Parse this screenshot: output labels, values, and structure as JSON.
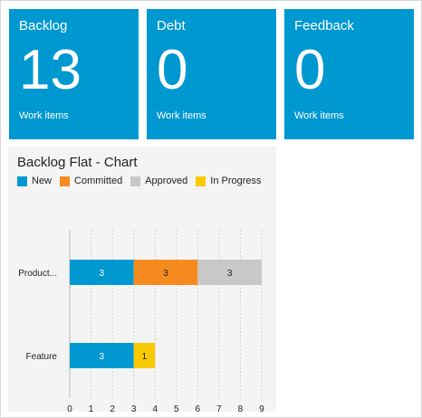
{
  "tiles": [
    {
      "title": "Backlog",
      "count": "13",
      "subtitle": "Work items"
    },
    {
      "title": "Debt",
      "count": "0",
      "subtitle": "Work items"
    },
    {
      "title": "Feedback",
      "count": "0",
      "subtitle": "Work items"
    }
  ],
  "colors": {
    "tile": "#0098d0",
    "New": "#0098d0",
    "Committed": "#f58b1f",
    "Approved": "#c8c8c8",
    "In Progress": "#f8c900"
  },
  "chart_data": {
    "type": "bar",
    "orientation": "horizontal",
    "stacked": true,
    "title": "Backlog Flat - Chart",
    "legend": [
      "New",
      "Committed",
      "Approved",
      "In Progress"
    ],
    "legend_position": "top-left",
    "categories": [
      "Product...",
      "Feature"
    ],
    "series": [
      {
        "name": "New",
        "values": [
          3,
          3
        ]
      },
      {
        "name": "Committed",
        "values": [
          3,
          0
        ]
      },
      {
        "name": "Approved",
        "values": [
          3,
          0
        ]
      },
      {
        "name": "In Progress",
        "values": [
          0,
          1
        ]
      }
    ],
    "xlim": [
      0,
      9
    ],
    "xticks": [
      "0",
      "1",
      "2",
      "3",
      "4",
      "5",
      "6",
      "7",
      "8",
      "9"
    ],
    "grid": true
  }
}
